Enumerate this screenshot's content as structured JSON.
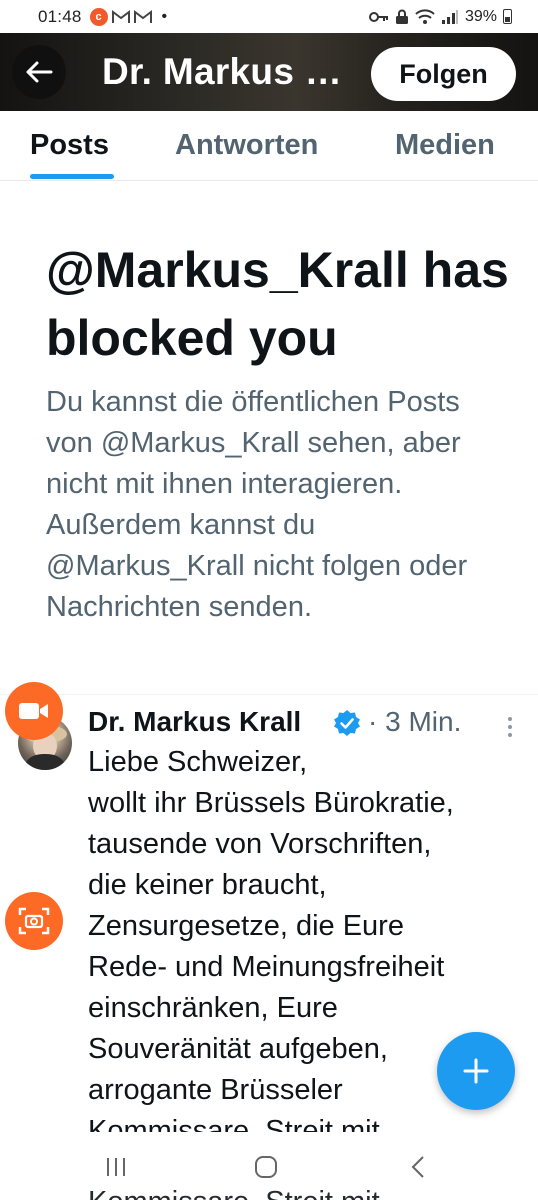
{
  "status_bar": {
    "time": "01:48",
    "battery": "39%"
  },
  "header": {
    "title": "Dr. Markus Krall",
    "follow_label": "Folgen"
  },
  "tabs": [
    {
      "label": "Posts",
      "active": true
    },
    {
      "label": "Antworten",
      "active": false
    },
    {
      "label": "Medien",
      "active": false
    }
  ],
  "blocked": {
    "title": "@Markus_Krall has blocked you",
    "body": "Du kannst die öffentlichen Posts von @Markus_Krall sehen, aber nicht mit ihnen interagieren. Außerdem kannst du @Markus_Krall nicht folgen oder Nachrichten senden."
  },
  "post": {
    "author": "Dr. Markus Krall",
    "meta": "· 3 Min.",
    "text": "Liebe Schweizer,\nwollt ihr Brüssels Bürokratie,\ntausende von Vorschriften,\ndie keiner braucht,\nZensurgesetze, die Eure\nRede- und Meinungsfreiheit\neinschränken, Eure\nSouveränität aufgeben,\narrogante Brüsseler\nKommissare, Streit mit"
  },
  "peek_text": "Kommissare, Streit mit",
  "colors": {
    "accent": "#1d9bf0",
    "overlay_orange": "#fc6a26",
    "secondary_text": "#536471"
  },
  "icons": {
    "back": "arrow-left-icon",
    "verified": "verified-badge-icon",
    "compose": "plus-icon",
    "record": "video-record-icon",
    "screenshot": "screenshot-camera-icon"
  }
}
